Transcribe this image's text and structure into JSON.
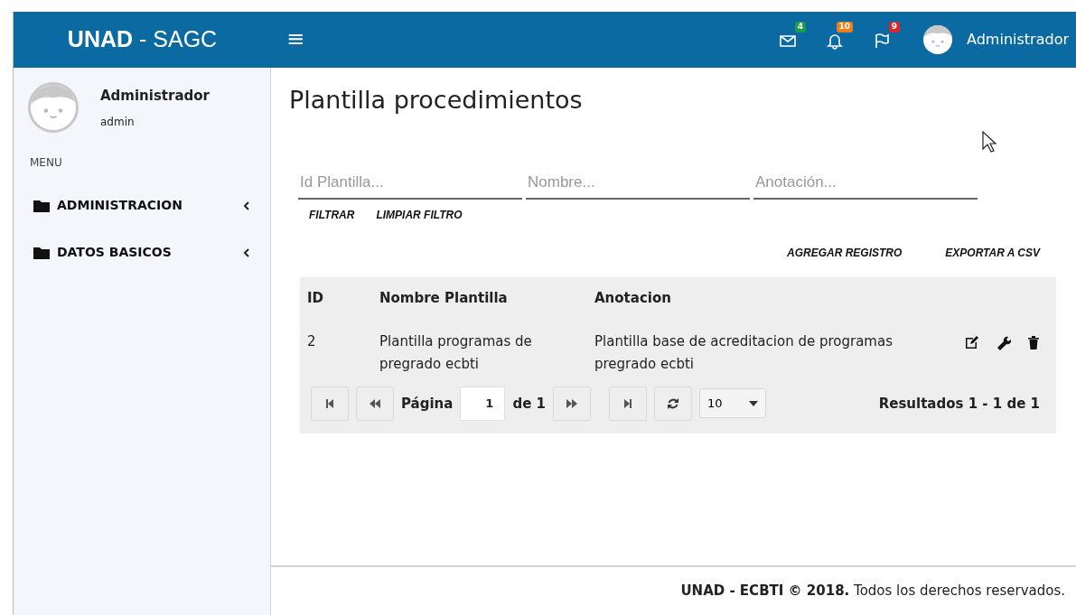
{
  "header": {
    "logo": "**UNAD** - SAGC",
    "menu_toggle": "≡",
    "notifications": [
      {
        "kind": "mail",
        "count": "4",
        "color": "#1e9b4a"
      },
      {
        "kind": "bell",
        "count": "10",
        "color": "#f07d1a"
      },
      {
        "kind": "flag",
        "count": "9",
        "color": "#d9262e"
      }
    ],
    "user": "Administrador"
  },
  "sidebar": {
    "user_name": "Administrador",
    "user_login": "admin",
    "menu_label": "MENU",
    "items": [
      {
        "label": "ADMINISTRACION",
        "expanded": false
      },
      {
        "label": "DATOS BASICOS",
        "expanded": false
      }
    ]
  },
  "page": {
    "title": "Plantilla procedimientos",
    "filters": [
      {
        "placeholder": "Id Plantilla..."
      },
      {
        "placeholder": "Nombre..."
      },
      {
        "placeholder": "Anotación..."
      }
    ],
    "filter_buttons": [
      "FILTRAR",
      "LIMPIAR FILTRO"
    ],
    "actions": [
      "AGREGAR REGISTRO",
      "EXPORTAR A CSV"
    ]
  },
  "table": {
    "columns": [
      "ID",
      "Nombre Plantilla",
      "Anotacion"
    ],
    "rows": [
      {
        "cells": [
          "2",
          "Plantilla programas de pregrado ecbti",
          "Plantilla base de acreditacion de programas pregrado ecbti"
        ],
        "row_actions": [
          {
            "kind": "edit"
          },
          {
            "kind": "settings"
          },
          {
            "kind": "delete"
          }
        ]
      }
    ]
  },
  "pager": {
    "page_label": "Página",
    "page": "1",
    "of_label": "de 1",
    "page_size": "10",
    "results": "Resultados 1 - 1 de 1"
  },
  "footer": "**UNAD - ECBTI © 2018.** Todos los derechos reservados."
}
